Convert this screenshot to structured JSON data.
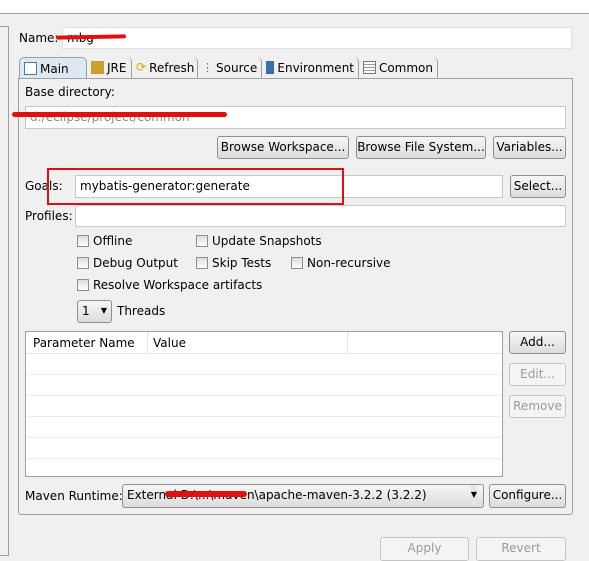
{
  "name": {
    "label": "Name:",
    "value": "mbg"
  },
  "tabs": [
    {
      "label": "Main",
      "icon": "main-tab-icon",
      "active": true
    },
    {
      "label": "JRE",
      "icon": "jre-icon"
    },
    {
      "label": "Refresh",
      "icon": "refresh-icon"
    },
    {
      "label": "Source",
      "icon": "source-icon"
    },
    {
      "label": "Environment",
      "icon": "environment-icon"
    },
    {
      "label": "Common",
      "icon": "common-icon"
    }
  ],
  "base_dir": {
    "label": "Base directory:",
    "value": "d:/eclipse/project/common"
  },
  "buttons": {
    "browse_workspace": "Browse Workspace...",
    "browse_fs": "Browse File System...",
    "variables": "Variables...",
    "select": "Select...",
    "add": "Add...",
    "edit": "Edit...",
    "remove": "Remove",
    "configure": "Configure...",
    "apply": "Apply",
    "revert": "Revert"
  },
  "goals": {
    "label": "Goals:",
    "value": "mybatis-generator:generate"
  },
  "profiles": {
    "label": "Profiles:",
    "value": ""
  },
  "options": {
    "offline": "Offline",
    "update_snapshots": "Update Snapshots",
    "debug_output": "Debug Output",
    "skip_tests": "Skip Tests",
    "non_recursive": "Non-recursive",
    "resolve_workspace": "Resolve Workspace artifacts"
  },
  "threads": {
    "value": "1",
    "label": "Threads"
  },
  "params_table": {
    "columns": [
      "Parameter Name",
      "Value",
      ""
    ],
    "rows": []
  },
  "runtime": {
    "label": "Maven Runtime:",
    "value": "External D:\\...\\maven\\apache-maven-3.2.2 (3.2.2)"
  },
  "colors": {
    "highlight": "#e01010",
    "tab_active": "#dde8f3"
  }
}
